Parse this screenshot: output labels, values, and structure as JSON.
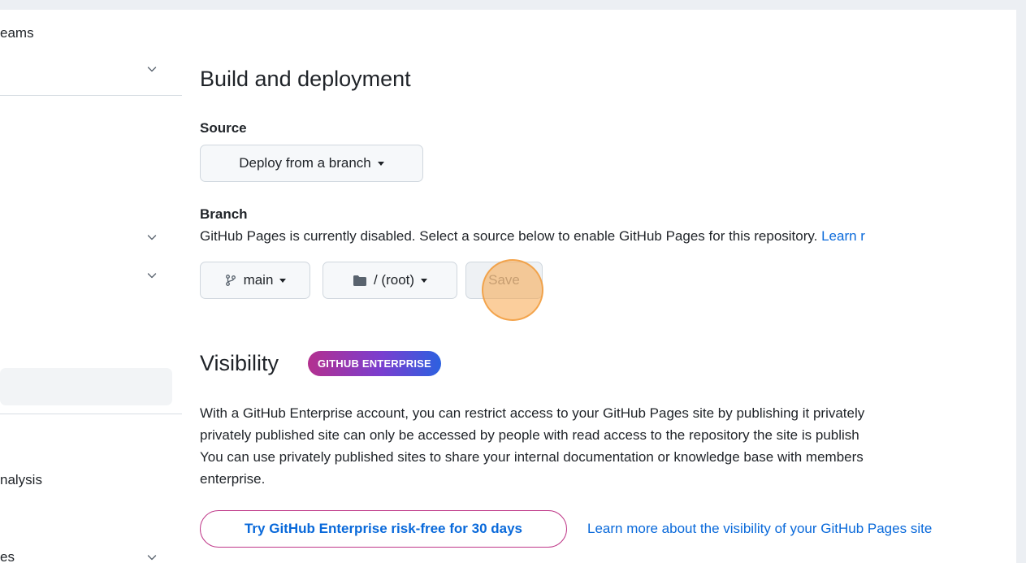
{
  "sidebar": {
    "items": [
      {
        "label": "eams",
        "chevron": false
      },
      {
        "label": "",
        "chevron": true
      },
      {
        "label": "",
        "chevron": true
      },
      {
        "label": "",
        "chevron": true
      },
      {
        "label": "",
        "active": true
      },
      {
        "label": "nalysis",
        "chevron": false
      },
      {
        "label": "es",
        "chevron": true
      }
    ]
  },
  "main": {
    "build": {
      "heading": "Build and deployment",
      "source_label": "Source",
      "source_select": "Deploy from a branch",
      "branch_label": "Branch",
      "branch_desc": "GitHub Pages is currently disabled. Select a source below to enable GitHub Pages for this repository.",
      "learn_link": "Learn r",
      "branch_select": "main",
      "folder_select": "/ (root)",
      "save_label": "Save"
    },
    "visibility": {
      "heading": "Visibility",
      "badge": "GITHUB ENTERPRISE",
      "lines": [
        "With a GitHub Enterprise account, you can restrict access to your GitHub Pages site by publishing it privately",
        "privately published site can only be accessed by people with read access to the repository the site is publish",
        "You can use privately published sites to share your internal documentation or knowledge base with members",
        "enterprise."
      ],
      "trial_button": "Try GitHub Enterprise risk-free for 30 days",
      "learn_more": "Learn more about the visibility of your GitHub Pages site"
    }
  },
  "icons": {
    "chevron": "chevron-down-icon",
    "branch": "git-branch-icon",
    "folder": "folder-icon"
  },
  "colors": {
    "link": "#0969da",
    "badge_start": "#b3308f",
    "badge_end": "#2c61e0",
    "enterprise_border": "#bf3989",
    "click_marker": "#f7a64a"
  }
}
